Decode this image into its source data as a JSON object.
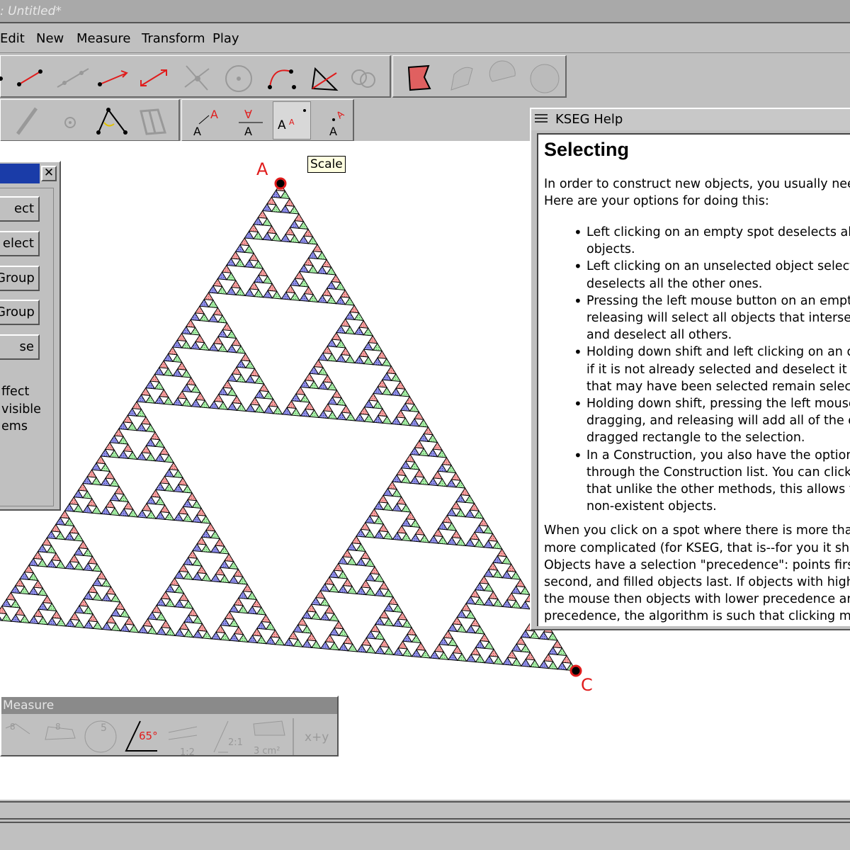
{
  "window": {
    "title": ": Untitled*"
  },
  "menu": {
    "items": [
      "Edit",
      "New",
      "Measure",
      "Transform",
      "Play"
    ]
  },
  "tooltip": {
    "text": "Scale"
  },
  "selection_panel": {
    "buttons": [
      "ect",
      "elect",
      "Group",
      " Group",
      "se"
    ],
    "note_lines": [
      "ffect",
      "visible",
      "ems"
    ]
  },
  "canvas": {
    "points": [
      {
        "label": "A"
      },
      {
        "label": "C"
      }
    ]
  },
  "help": {
    "title": "KSEG Help",
    "heading": "Selecting",
    "intro": [
      "In order to construct new objects, you usually need",
      "Here are your options for doing this:"
    ],
    "bullets": [
      [
        "Left clicking on an empty spot deselects all o",
        "objects."
      ],
      [
        "Left clicking on an unselected object selects",
        "deselects all the other ones."
      ],
      [
        "Pressing the left mouse button on an empty s",
        "releasing will select all objects that intersect",
        "and deselect all others."
      ],
      [
        "Holding down shift and left clicking on an ob",
        "if it is not already selected and deselect it ot",
        "that may have been selected remain selecte"
      ],
      [
        "Holding down shift, pressing the left mouse b",
        "dragging, and releasing will add all of the ob",
        "dragged rectangle to the selection."
      ],
      [
        "In a Construction, you also have the option o",
        "through the Construction list. You can click o",
        "that unlike the other methods, this allows you",
        "non-existent objects."
      ]
    ],
    "paragraph": [
      "When you click on a spot where there is more than",
      "more complicated (for KSEG, that is--for you it sho",
      "Objects have a selection \"precedence\": points first,",
      "second, and filled objects last. If objects with higher",
      "the mouse then objects with lower precedence are i",
      "precedence, the algorithm is such that clicking mult"
    ]
  },
  "measure": {
    "title": "Measure",
    "labels": {
      "angle": "65°",
      "ratio": "1:2",
      "ratio2": "2:1",
      "area": "3 cm²",
      "calc": "x+y",
      "len1": "8",
      "len2": "8",
      "circ": "5"
    }
  },
  "colors": {
    "red": "#e01c1c",
    "fractal_red": "#f28b8b",
    "fractal_blue": "#7b7bd8",
    "fractal_green": "#8ee08e"
  }
}
